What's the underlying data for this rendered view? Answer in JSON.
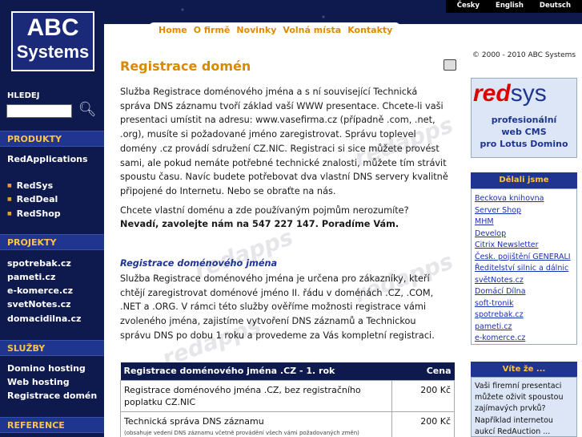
{
  "lang": [
    "Česky",
    "English",
    "Deutsch"
  ],
  "logo": {
    "line1": "ABC",
    "line2": "Systems"
  },
  "search": {
    "label": "HLEDEJ"
  },
  "sidebar": {
    "produkty": "PRODUKTY",
    "redapps": "RedApplications",
    "products": [
      "RedSys",
      "RedDeal",
      "RedShop"
    ],
    "projekty": "PROJEKTY",
    "projects": [
      "spotrebak.cz",
      "pameti.cz",
      "e-komerce.cz",
      "svetNotes.cz",
      "domacidilna.cz"
    ],
    "sluzby": "SLUŽBY",
    "services": [
      "Domino hosting",
      "Web hosting",
      "Registrace domén"
    ],
    "reference": "REFERENCE"
  },
  "tabs": [
    "Home",
    "O firmě",
    "Novinky",
    "Volná místa",
    "Kontakty"
  ],
  "title": "Registrace domén",
  "intro": "Služba Registrace doménového jména a s ní související Technická správa DNS záznamu tvoří základ vaší WWW presentace. Chcete-li vaši presentaci umístit na adresu: www.vasefirma.cz (případně .com, .net, .org), musíte si požadované jméno zaregistrovat. Správu toplevel domény .cz provádí sdružení CZ.NIC. Registraci si sice můžete provést sami, ale pokud nemáte potřebné technické znalosti, můžete tím strávit spoustu času. Navíc budete potřebovat dva vlastní DNS servery kvalitně připojené do Internetu. Nebo se obraťte na nás.",
  "question": "Chcete vlastní doménu a zde používaným pojmům nerozumíte?",
  "call": "Nevadí, zavolejte nám na 547 227 147. Poradíme Vám.",
  "subhead": "Registrace doménového jména",
  "detail": "Služba Registrace doménového jména je určena pro zákazníky, kteří chtějí zaregistrovat doménové jméno II. řádu v doménách .CZ, .COM, .NET a .ORG. V rámci této služby ověříme možnosti registrace vámi zvoleného jména, zajistíme vytvoření DNS záznamů a Technickou správu DNS po dobu 1 roku a provedeme za Vás kompletní registraci.",
  "watermark": "redapps",
  "table": {
    "head": "Registrace doménového jména .CZ - 1. rok",
    "price_head": "Cena",
    "rows": [
      {
        "label": "Registrace doménového jména .CZ, bez registračního poplatku CZ.NIC",
        "price": "200 Kč"
      },
      {
        "label": "Technická správa DNS záznamu",
        "note": "(obsahuje vedení DNS záznamu včetně provádění všech vámi požadovaných změn)",
        "price": "200 Kč"
      }
    ]
  },
  "copyright": "© 2000 - 2010 ABC Systems",
  "ad": {
    "brand_red": "red",
    "brand_sys": "sys",
    "line1": "profesionální",
    "line2": "web CMS",
    "line3": "pro Lotus Domino"
  },
  "worked": {
    "title": "Dělali jsme",
    "items": [
      "Beckova knihovna",
      "Server Shop",
      "MHM",
      "Develop",
      "Citrix Newsletter",
      "Česk. pojištění GENERALI",
      "Ředitelství silnic a dálnic",
      "světNotes.cz",
      "Domácí Dílna",
      "soft-tronik",
      "spotrebak.cz",
      "pameti.cz",
      "e-komerce.cz"
    ]
  },
  "tip": {
    "title": "Víte že ...",
    "text": "Vaši firemní presentaci můžete oživit spoustou zajímavých prvků? Například internetou aukcí RedAuction ..."
  }
}
